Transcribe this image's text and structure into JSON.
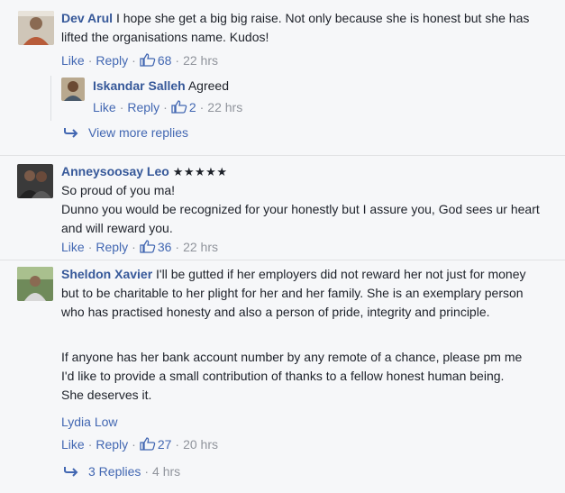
{
  "actions": {
    "like": "Like",
    "reply": "Reply",
    "sep": "·"
  },
  "comments": [
    {
      "author": "Dev Arul",
      "text": "I hope she get a big big raise. Not only because she is honest but she has lifted the organisations name. Kudos!",
      "likes": "68",
      "time": "22 hrs",
      "reply": {
        "author": "Iskandar Salleh",
        "text": "Agreed",
        "likes": "2",
        "time": "22 hrs"
      },
      "more_replies": "View more replies"
    },
    {
      "author": "Anneysoosay Leo",
      "stars": "★★★★★",
      "line1": "So proud of you ma!",
      "line2": "Dunno you would be recognized for your honestly but I assure you, God sees ur heart and will reward you.",
      "likes": "36",
      "time": "22 hrs"
    },
    {
      "author": "Sheldon Xavier",
      "text": "I'll be gutted if her employers did not reward her not just for money but to be charitable to her plight for her and her family. She is an exemplary person who has practised honesty and also a person of pride, integrity and principle.",
      "para2": "If anyone has her bank account number by any remote of a chance, please pm me I'd like to provide a small contribution of thanks to a fellow honest human being. She deserves it.",
      "tag": "Lydia Low",
      "likes": "27",
      "time": "20 hrs",
      "replies_label": "3 Replies",
      "replies_time": "4 hrs"
    }
  ]
}
